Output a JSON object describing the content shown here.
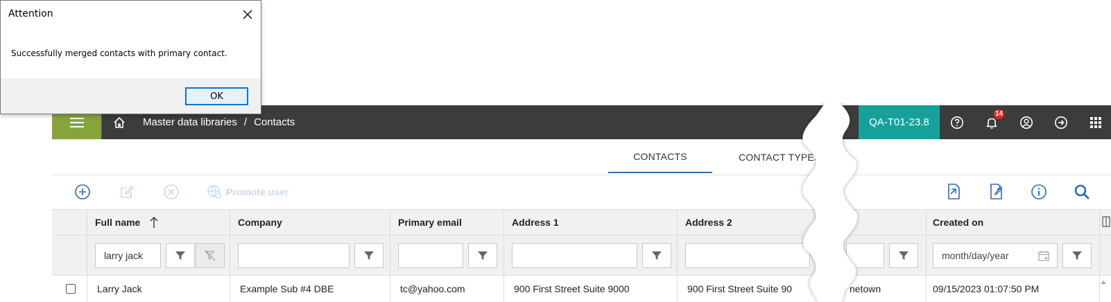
{
  "dialog": {
    "title": "Attention",
    "message": "Successfully merged contacts with primary contact.",
    "ok_label": "OK"
  },
  "topbar": {
    "breadcrumb_parent": "Master data libraries",
    "breadcrumb_sep": "/",
    "breadcrumb_current": "Contacts",
    "env_label": "QA-T01-23.8",
    "notifications_count": "14"
  },
  "tabs": [
    {
      "label": "CONTACTS",
      "active": true
    },
    {
      "label": "CONTACT TYPES",
      "active": false
    }
  ],
  "toolbar": {
    "promote_label": "Promote user"
  },
  "grid": {
    "columns": [
      "Full name",
      "Company",
      "Primary email",
      "Address 1",
      "Address 2",
      "Created on"
    ],
    "filters": {
      "full_name": "larry jack",
      "created_on_placeholder": "month/day/year"
    },
    "row": {
      "full_name": "Larry Jack",
      "company": "Example Sub #4 DBE",
      "email": "tc@yahoo.com",
      "address1": "900 First Street Suite 9000",
      "address2": "900 First Street Suite 90",
      "city_fragment": "netown",
      "created_on": "09/15/2023 01:07:50 PM"
    }
  },
  "colors": {
    "topbar": "#3c3c3c",
    "menu": "#87a33b",
    "env_badge": "#15a19a",
    "accent": "#2b6cb0",
    "notification": "#e02424"
  }
}
